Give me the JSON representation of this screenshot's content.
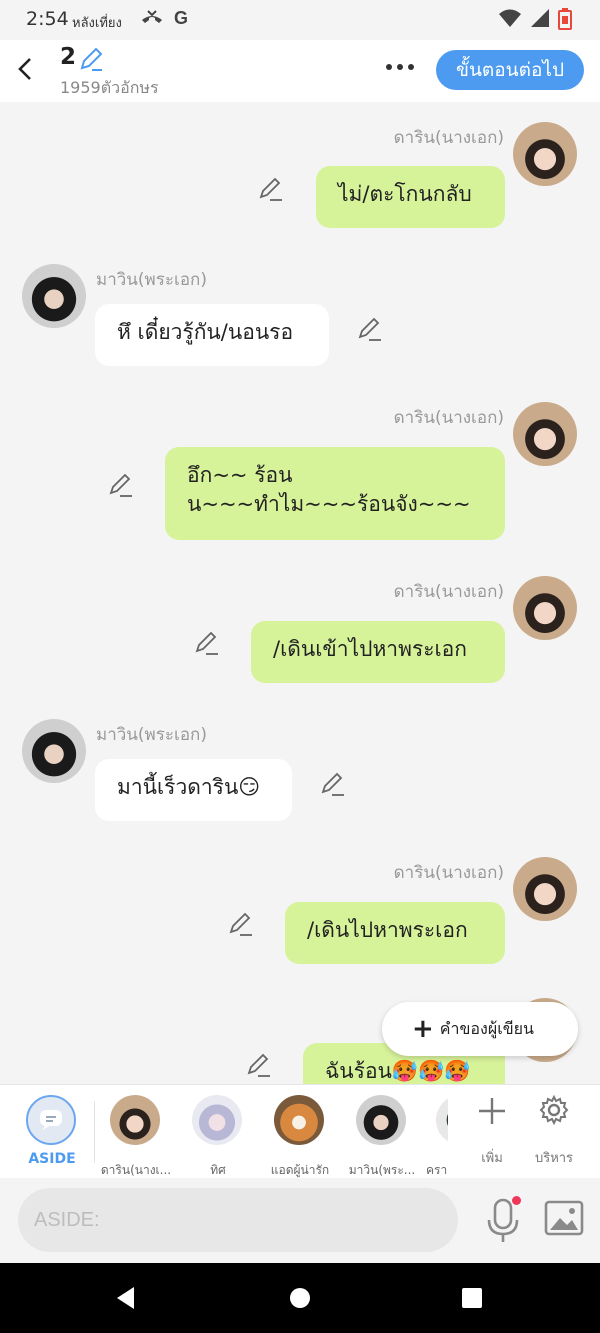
{
  "status": {
    "time": "2:54",
    "period": "หลังเที่ยง",
    "icons": [
      "missed-call-icon",
      "google-icon",
      "wifi-icon",
      "signal-icon",
      "battery-low-icon"
    ]
  },
  "header": {
    "title": "2",
    "subtitle": "1959ตัวอักษร",
    "more_icon": "more-dots-icon",
    "next_label": "ขั้นตอนต่อไป"
  },
  "messages": [
    {
      "side": "right",
      "name": "ดาริน(นางเอก)",
      "text": "ไม่/ตะโกนกลับ"
    },
    {
      "side": "left",
      "name": "มาวิน(พระเอก)",
      "text": "หึ เดี๋ยวรู้กัน/นอนรอ"
    },
    {
      "side": "right",
      "name": "ดาริน(นางเอก)",
      "text": "อึก~~ ร้อน\nน~~~ทำไม~~~ร้อนจัง~~~"
    },
    {
      "side": "right",
      "name": "ดาริน(นางเอก)",
      "text": "/เดินเข้าไปหาพระเอก"
    },
    {
      "side": "left",
      "name": "มาวิน(พระเอก)",
      "text": "มานี้เร็วดาริน😏"
    },
    {
      "side": "right",
      "name": "ดาริน(นางเอก)",
      "text": "/เดินไปหาพระเอก"
    },
    {
      "side": "right",
      "name": "",
      "text": "ฉันร้อน🥵🥵🥵"
    }
  ],
  "author_button": {
    "label": "คำของผู้เขียน"
  },
  "characters": {
    "aside_label": "ASIDE",
    "items": [
      {
        "label": "ดาริน(นางเ..."
      },
      {
        "label": "ทิศ"
      },
      {
        "label": "แอดผู้น่ารัก"
      },
      {
        "label": "มาวิน(พระ..."
      },
      {
        "label": "ครา"
      }
    ],
    "add_label": "เพิ่ม",
    "manage_label": "บริหาร"
  },
  "input": {
    "placeholder": "ASIDE:"
  },
  "colors": {
    "accent": "#4d9bf0",
    "green_bubble": "#d7f39a",
    "white_bubble": "#ffffff",
    "mic_dot": "#f0375a"
  }
}
